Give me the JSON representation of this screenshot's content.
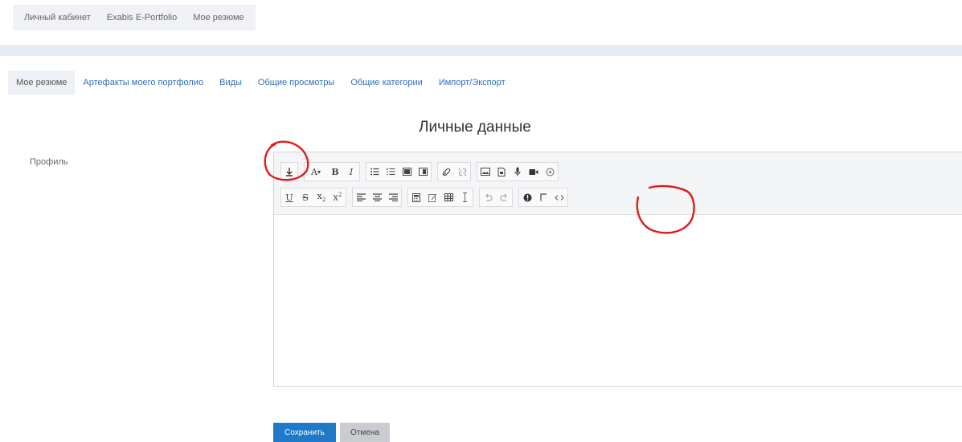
{
  "breadcrumb": {
    "items": [
      "Личный кабинет",
      "Exabis E-Portfolio",
      "Мое резюме"
    ]
  },
  "tabs": [
    {
      "label": "Мое резюме",
      "active": true
    },
    {
      "label": "Артефакты моего портфолио"
    },
    {
      "label": "Виды"
    },
    {
      "label": "Общие просмотры"
    },
    {
      "label": "Общие категории"
    },
    {
      "label": "Импорт/Экспорт"
    }
  ],
  "page": {
    "title": "Личные данные",
    "field_label": "Профиль"
  },
  "editor": {
    "toolbar_row1": [
      "toggle-toolbar",
      "font-size",
      "bold",
      "italic",
      "unordered-list",
      "ordered-list",
      "indent",
      "outdent",
      "link",
      "unlink",
      "image",
      "media",
      "record-audio",
      "record-video",
      "manage-files"
    ],
    "toolbar_row2": [
      "underline",
      "strikethrough",
      "subscript",
      "superscript",
      "align-left",
      "align-center",
      "align-right",
      "equation",
      "special-chars",
      "table",
      "clear-formatting",
      "undo",
      "redo",
      "accessibility-checker",
      "screenreader-helper",
      "html-source"
    ],
    "content": ""
  },
  "buttons": {
    "save": "Сохранить",
    "cancel": "Отмена"
  },
  "colors": {
    "accent": "#1f78c8",
    "annotation": "#e01b1b",
    "link": "#2f6fb5"
  }
}
